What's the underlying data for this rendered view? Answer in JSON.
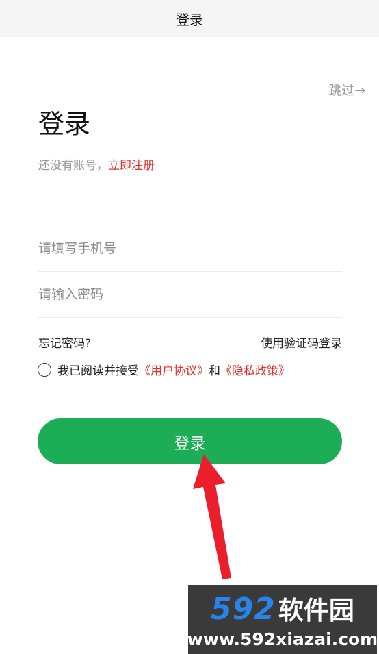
{
  "header": {
    "title": "登录"
  },
  "skip_label": "跳过→",
  "page_heading": "登录",
  "register": {
    "prompt": "还没有账号，",
    "link": "立即注册"
  },
  "phone_field": {
    "placeholder": "请填写手机号",
    "value": ""
  },
  "password_field": {
    "placeholder": "请输入密码",
    "value": ""
  },
  "forgot_password": "忘记密码?",
  "code_login": "使用验证码登录",
  "agreement": {
    "prefix": "我已阅读并接受",
    "user_agreement": "《用户协议》",
    "and": "和",
    "privacy_policy": "《隐私政策》",
    "checked": false
  },
  "login_button": "登录",
  "watermark": {
    "number": "592",
    "brand": "软件园",
    "url": "www.592xiazai.com"
  },
  "colors": {
    "accent_green": "#1dad56",
    "link_red": "#e0312b",
    "arrow_red": "#ea1f2b"
  }
}
